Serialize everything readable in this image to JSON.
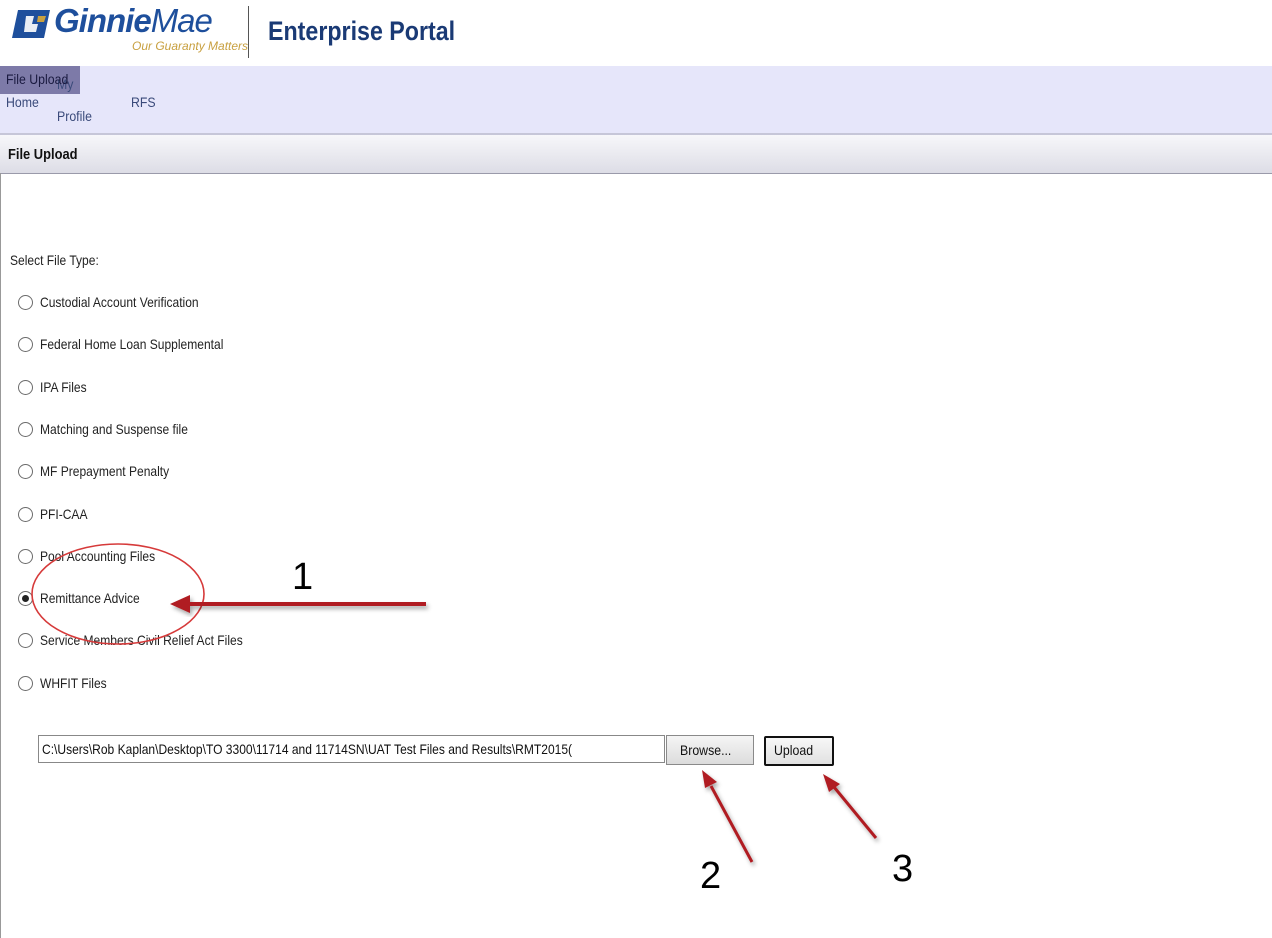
{
  "header": {
    "logo_bold": "Ginnie",
    "logo_light": "Mae",
    "tagline": "Our Guaranty Matters",
    "portal_title": "Enterprise Portal"
  },
  "nav": {
    "home": "Home",
    "my": "My",
    "profile": "Profile",
    "rfs": "RFS",
    "file_upload": "File Upload"
  },
  "section": {
    "title": "File Upload"
  },
  "form": {
    "select_label": "Select File Type:",
    "options": [
      {
        "label": "Custodial Account Verification",
        "checked": false
      },
      {
        "label": "Federal Home Loan Supplemental",
        "checked": false
      },
      {
        "label": "IPA Files",
        "checked": false
      },
      {
        "label": "Matching and Suspense file",
        "checked": false
      },
      {
        "label": "MF Prepayment Penalty",
        "checked": false
      },
      {
        "label": "PFI-CAA",
        "checked": false
      },
      {
        "label": "Pool Accounting Files",
        "checked": false
      },
      {
        "label": "Remittance Advice",
        "checked": true
      },
      {
        "label": "Service Members Civil Relief Act Files",
        "checked": false
      },
      {
        "label": "WHFIT Files",
        "checked": false
      }
    ],
    "file_path": "C:\\Users\\Rob Kaplan\\Desktop\\TO 3300\\11714 and 11714SN\\UAT Test Files and Results\\RMT2015(",
    "browse_label": "Browse...",
    "upload_label": "Upload"
  },
  "annotations": {
    "step1": "1",
    "step2": "2",
    "step3": "3",
    "color": "#b01e23"
  }
}
